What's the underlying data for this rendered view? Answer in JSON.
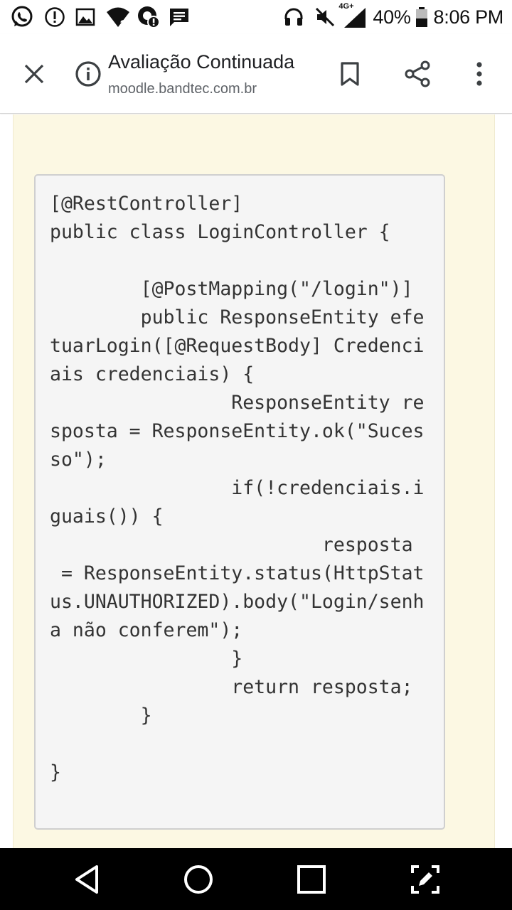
{
  "status_bar": {
    "network_label": "4G+",
    "battery_percent": "40%",
    "time": "8:06 PM",
    "icons": [
      "whatsapp-icon",
      "alert-icon",
      "gallery-icon",
      "wifi-question-icon",
      "data-saver-icon",
      "message-icon",
      "headset-icon",
      "mute-icon",
      "signal-icon",
      "battery-icon"
    ]
  },
  "toolbar": {
    "title": "Avaliação Continuada",
    "url": "moodle.bandtec.com.br",
    "icons": [
      "close-icon",
      "info-icon",
      "bookmark-icon",
      "share-icon",
      "more-icon"
    ]
  },
  "code": {
    "lines": [
      "[@RestController]",
      "public class LoginController {",
      "",
      "        [@PostMapping(\"/login\")]",
      "        public ResponseEntity efe",
      "tuarLogin([@RequestBody] Credenci",
      "ais credenciais) {",
      "                ResponseEntity re",
      "sposta = ResponseEntity.ok(\"Suces",
      "so\");",
      "                if(!credenciais.i",
      "guais()) {",
      "                        resposta",
      " = ResponseEntity.status(HttpStat",
      "us.UNAUTHORIZED).body(\"Login/senh",
      "a não conferem\");",
      "                }",
      "                return resposta;",
      "        }",
      "",
      "}"
    ]
  },
  "nav_bar": {
    "icons": [
      "back-icon",
      "home-icon",
      "recents-icon",
      "screenshot-edit-icon"
    ]
  },
  "colors": {
    "panel_background": "#fcf8e3",
    "code_background": "#f5f5f5",
    "code_text": "#333333"
  }
}
